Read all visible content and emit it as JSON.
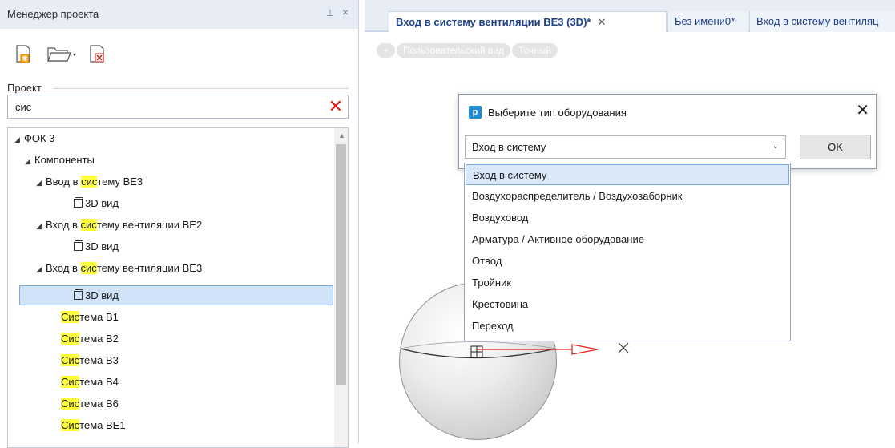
{
  "panel": {
    "title": "Менеджер проекта",
    "pin_glyph": "⊥",
    "close_glyph": "×",
    "toolbar": [
      "new-project-icon",
      "open-folder-icon",
      "delete-file-icon"
    ],
    "project_label": "Проект",
    "search_value": "сис",
    "search_clear_glyph": "✕"
  },
  "tree": {
    "rows": [
      {
        "prefix": "",
        "hl": "",
        "rest": "ФОК 3"
      },
      {
        "prefix": "",
        "hl": "",
        "rest": "Компоненты"
      },
      {
        "prefix": "Ввод в ",
        "hl": "сис",
        "rest": "тему ВЕ3"
      },
      {
        "prefix": "",
        "hl": "",
        "rest": "3D вид"
      },
      {
        "prefix": "Вход в ",
        "hl": "сис",
        "rest": "тему вентиляции ВЕ2"
      },
      {
        "prefix": "",
        "hl": "",
        "rest": "3D вид"
      },
      {
        "prefix": "Вход в ",
        "hl": "сис",
        "rest": "тему вентиляции ВЕ3"
      },
      {
        "prefix": "",
        "hl": "",
        "rest": "3D вид"
      },
      {
        "prefix": "",
        "hl": "Сис",
        "rest": "тема В1"
      },
      {
        "prefix": "",
        "hl": "Сис",
        "rest": "тема В2"
      },
      {
        "prefix": "",
        "hl": "Сис",
        "rest": "тема В3"
      },
      {
        "prefix": "",
        "hl": "Сис",
        "rest": "тема В4"
      },
      {
        "prefix": "",
        "hl": "Сис",
        "rest": "тема В6"
      },
      {
        "prefix": "",
        "hl": "Сис",
        "rest": "тема ВЕ1"
      }
    ]
  },
  "tabs": [
    {
      "label": "Вход в систему вентиляции ВЕ3 (3D)*",
      "close": "✕"
    },
    {
      "label": "Без имени0*"
    },
    {
      "label": "Вход в систему вентиляц"
    }
  ],
  "view_pills": [
    "+",
    "Пользовательский вид",
    "Точный"
  ],
  "dialog": {
    "icon_letter": "p",
    "title": "Выберите тип оборудования",
    "close_glyph": "✕",
    "combo_value": "Вход в систему",
    "combo_chevron": "⌄",
    "ok_label": "OK",
    "options": [
      "Вход в систему",
      "Воздухораспределитель / Воздухозаборник",
      "Воздуховод",
      "Арматура / Активное оборудование",
      "Отвод",
      "Тройник",
      "Крестовина",
      "Переход"
    ],
    "selected_index": 0
  },
  "colors": {
    "highlight": "#ffff3b",
    "selection": "#cfe2f7",
    "tab_text": "#1c3f86",
    "clear_x": "#e01515"
  }
}
